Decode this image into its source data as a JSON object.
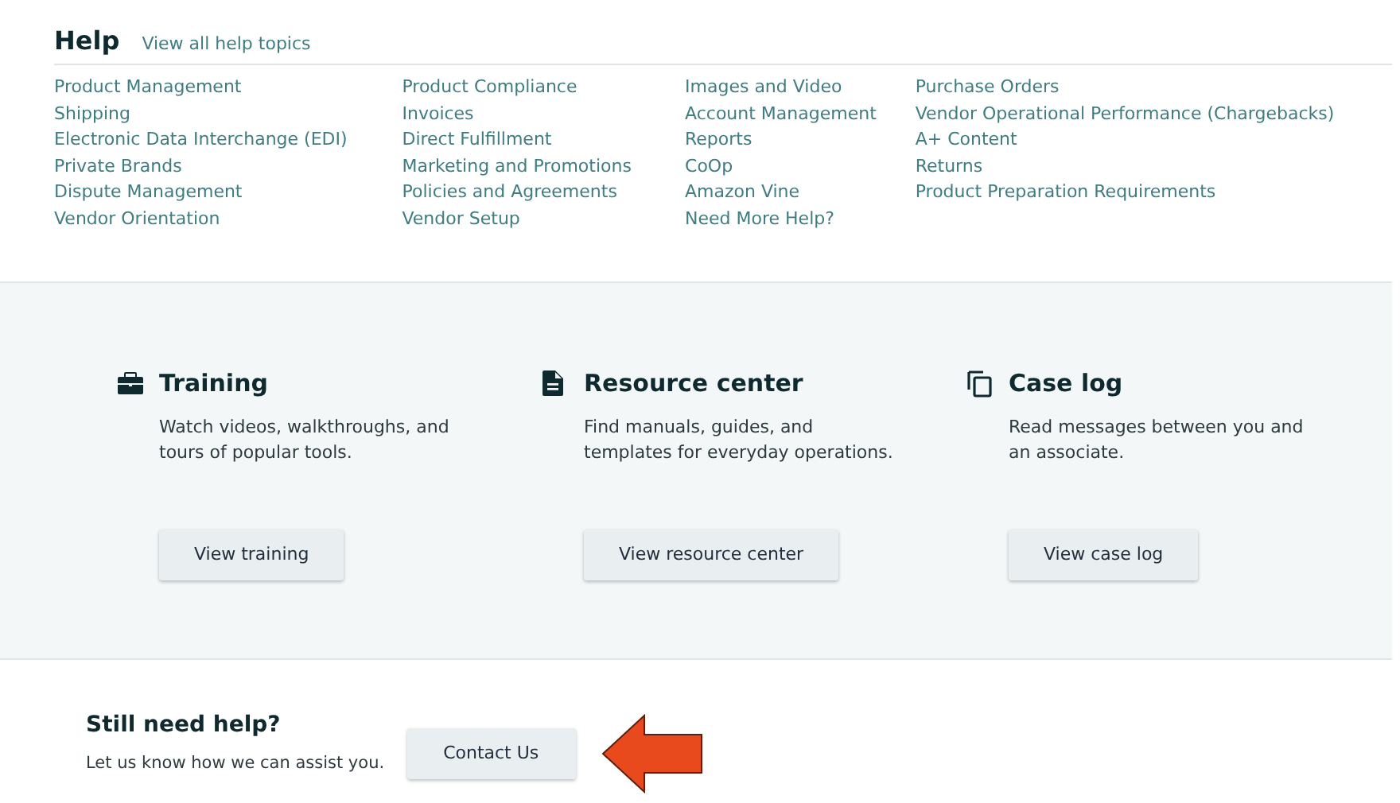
{
  "help": {
    "title": "Help",
    "view_all": "View all help topics",
    "columns": [
      [
        "Product Management",
        "Shipping",
        "Electronic Data Interchange (EDI)",
        "Private Brands",
        "Dispute Management",
        "Vendor Orientation"
      ],
      [
        "Product Compliance",
        "Invoices",
        "Direct Fulfillment",
        "Marketing and Promotions",
        "Policies and Agreements",
        "Vendor Setup"
      ],
      [
        "Images and Video",
        "Account Management",
        "Reports",
        "CoOp",
        "Amazon Vine",
        "Need More Help?"
      ],
      [
        "Purchase Orders",
        "Vendor Operational Performance (Chargebacks)",
        "A+ Content",
        "Returns",
        "Product Preparation Requirements"
      ]
    ]
  },
  "cards": [
    {
      "kind": "briefcase",
      "title": "Training",
      "description": "Watch videos, walkthroughs, and tours of popular tools.",
      "button": "View training"
    },
    {
      "kind": "document",
      "title": "Resource center",
      "description": "Find manuals, guides, and templates for everyday operations.",
      "button": "View resource center"
    },
    {
      "kind": "copy",
      "title": "Case log",
      "description": "Read messages between you and an associate.",
      "button": "View case log"
    }
  ],
  "contact": {
    "title": "Still need help?",
    "text": "Let us know how we can assist you.",
    "button": "Contact Us"
  }
}
